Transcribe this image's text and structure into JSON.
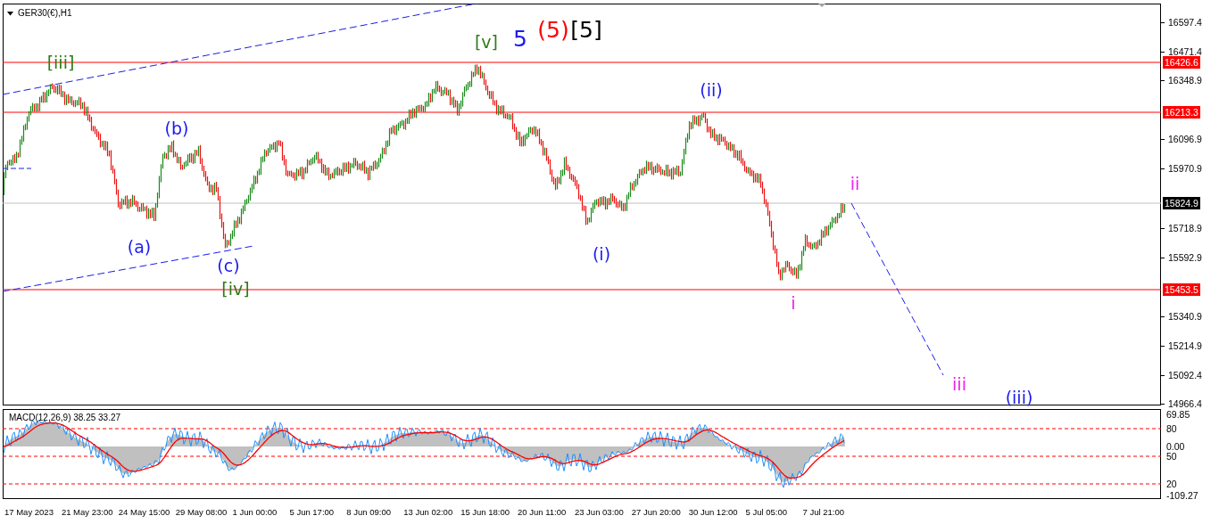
{
  "chart": {
    "title": "GER30(€),H1"
  },
  "wave_labels": [
    {
      "text": "[iii]",
      "color": "#2e7d16",
      "kind": "minor"
    },
    {
      "text": "(b)",
      "color": "#1a1aee",
      "kind": "minor"
    },
    {
      "text": "(a)",
      "color": "#1a1aee",
      "kind": "minor"
    },
    {
      "text": "(c)",
      "color": "#1a1aee",
      "kind": "minor"
    },
    {
      "text": "[iv]",
      "color": "#2e7d16",
      "kind": "minor"
    },
    {
      "text": "[v]",
      "color": "#2e7d16",
      "kind": "minor"
    },
    {
      "text": "5",
      "color": "#1a1aee",
      "kind": "major"
    },
    {
      "text": "(5)",
      "color": "#ff0000",
      "kind": "major"
    },
    {
      "text": "[5]",
      "color": "#000000",
      "kind": "major"
    },
    {
      "text": "(i)",
      "color": "#1a1aee",
      "kind": "minor"
    },
    {
      "text": "(ii)",
      "color": "#1a1aee",
      "kind": "minor"
    },
    {
      "text": "ii",
      "color": "#ee22ee",
      "kind": "minor"
    },
    {
      "text": "i",
      "color": "#ee22ee",
      "kind": "minor"
    },
    {
      "text": "iii",
      "color": "#ee22ee",
      "kind": "minor"
    },
    {
      "text": "(iii)",
      "color": "#1a1aee",
      "kind": "minor"
    }
  ],
  "price_axis": [
    "16597.4",
    "16471.4",
    "16348.9",
    "16096.9",
    "15970.9",
    "15718.9",
    "15592.9",
    "15340.9",
    "15214.9",
    "15092.4",
    "14966.4"
  ],
  "price_tags": [
    {
      "text": "16426.6",
      "kind": "level"
    },
    {
      "text": "16213.3",
      "kind": "level"
    },
    {
      "text": "15824.9",
      "kind": "current"
    },
    {
      "text": "15453.5",
      "kind": "level"
    }
  ],
  "macd": {
    "title": "MACD(12,26,9) 38.25 33.27",
    "axis": [
      "69.85",
      "80",
      "0.00",
      "50",
      "20",
      "-109.27"
    ]
  },
  "time_axis": [
    "17 May 2023",
    "21 May 23:00",
    "24 May 15:00",
    "29 May 08:00",
    "1 Jun 00:00",
    "5 Jun 17:00",
    "8 Jun 09:00",
    "13 Jun 02:00",
    "15 Jun 18:00",
    "20 Jun 11:00",
    "23 Jun 03:00",
    "27 Jun 20:00",
    "30 Jun 12:00",
    "5 Jul 05:00",
    "7 Jul 21:00"
  ]
}
